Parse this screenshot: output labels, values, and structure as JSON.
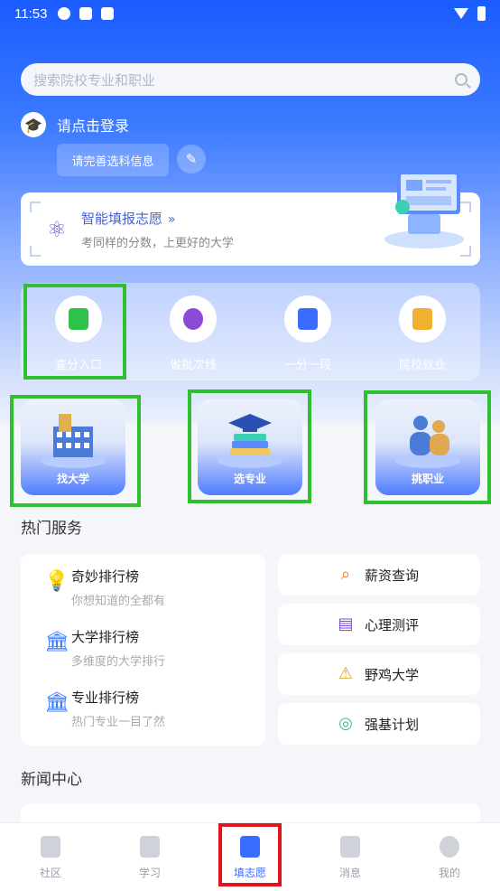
{
  "status_bar": {
    "time": "11:53"
  },
  "search": {
    "placeholder": "搜索院校专业和职业"
  },
  "login": {
    "prompt": "请点击登录",
    "complete_info": "请完善选科信息"
  },
  "smart_fill": {
    "title": "智能填报志愿",
    "arrow": "»",
    "subtitle": "考同样的分数，上更好的大学"
  },
  "quick_actions": [
    {
      "label": "查分入口",
      "icon": "pencil-note-icon",
      "color": "#2fc24a"
    },
    {
      "label": "省批次线",
      "icon": "chart-pie-icon",
      "color": "#8b4bd8"
    },
    {
      "label": "一分一段",
      "icon": "document-segment-icon",
      "color": "#3a6dff"
    },
    {
      "label": "院校就业",
      "icon": "briefcase-check-icon",
      "color": "#f2b030"
    }
  ],
  "big_cards": [
    {
      "label": "找大学",
      "icon": "university-building-icon"
    },
    {
      "label": "选专业",
      "icon": "graduation-books-icon"
    },
    {
      "label": "挑职业",
      "icon": "career-people-icon"
    }
  ],
  "hot_services": {
    "title": "热门服务",
    "left": [
      {
        "title": "奇妙排行榜",
        "subtitle": "你想知道的全都有",
        "icon": "lightbulb-icon"
      },
      {
        "title": "大学排行榜",
        "subtitle": "多维度的大学排行",
        "icon": "school-building-icon"
      },
      {
        "title": "专业排行榜",
        "subtitle": "热门专业一目了然",
        "icon": "school-building-icon"
      }
    ],
    "right": [
      {
        "title": "薪资查询",
        "icon": "magnifier-icon",
        "color": "#f07a2a"
      },
      {
        "title": "心理测评",
        "icon": "clipboard-icon",
        "color": "#7a4bd8"
      },
      {
        "title": "野鸡大学",
        "icon": "warning-bell-icon",
        "color": "#e0a020"
      },
      {
        "title": "强基计划",
        "icon": "wave-circle-icon",
        "color": "#2fbfa0"
      }
    ]
  },
  "news": {
    "title": "新闻中心"
  },
  "tabbar": [
    {
      "label": "社区",
      "icon": "community-icon"
    },
    {
      "label": "学习",
      "icon": "book-icon"
    },
    {
      "label": "填志愿",
      "icon": "form-icon"
    },
    {
      "label": "消息",
      "icon": "message-icon"
    },
    {
      "label": "我的",
      "icon": "profile-icon"
    }
  ]
}
